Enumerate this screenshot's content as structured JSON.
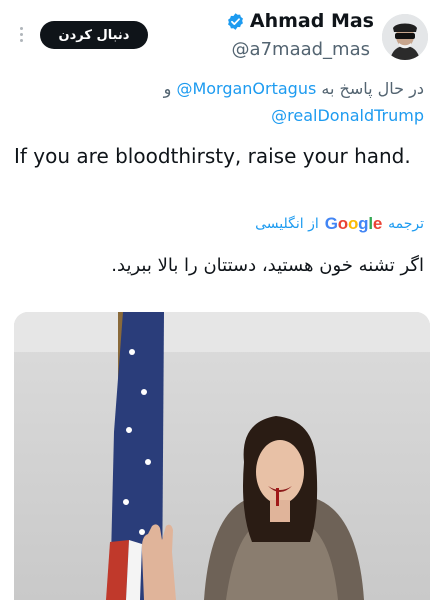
{
  "header": {
    "follow_label": "دنبال کردن",
    "display_name": "Ahmad Mas",
    "handle": "@a7maad_mas"
  },
  "reply_context": {
    "prefix": "در حال پاسخ به",
    "mention_1": "@MorganOrtagus",
    "conjunction": "و",
    "mention_2": "@realDonaldTrump"
  },
  "tweet": {
    "text": "If you are bloodthirsty, raise your hand."
  },
  "translation": {
    "label": "ترجمه",
    "provider": "Google",
    "from_language": "از انگلیسی",
    "text": "اگر تشنه خون هستید، دستتان را بالا ببرید."
  },
  "colors": {
    "accent": "#1d9bf0",
    "text_primary": "#0f1419",
    "text_secondary": "#536471",
    "follow_button_bg": "#0f1419"
  },
  "icons": {
    "more": "more-options-icon",
    "verified": "verified-badge-icon"
  }
}
